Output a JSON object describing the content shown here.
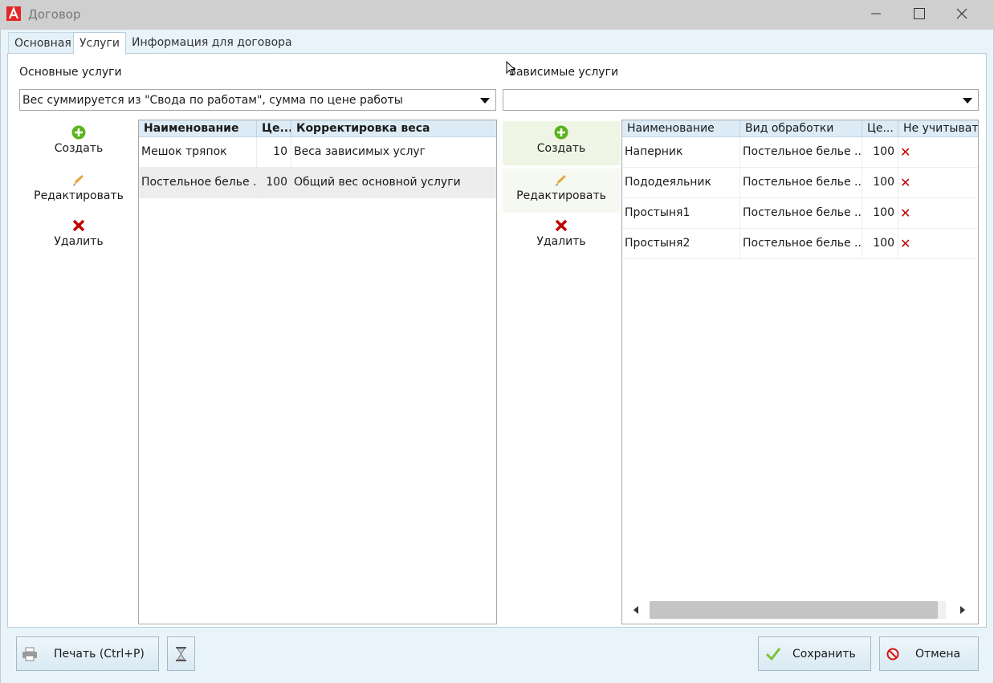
{
  "window": {
    "title": "Договор",
    "controls": {
      "minimize": "—",
      "maximize": "☐",
      "close": "✕"
    }
  },
  "tabs": [
    {
      "label": "Основная",
      "active": false
    },
    {
      "label": "Услуги",
      "active": true
    },
    {
      "label": "Информация для договора",
      "active": false
    }
  ],
  "main_services": {
    "label": "Основные услуги",
    "combo_value": "Вес суммируется из \"Свода по работам\", сумма по цене работы",
    "actions": {
      "create": "Создать",
      "edit": "Редактировать",
      "delete": "Удалить"
    },
    "columns": [
      "Наименование",
      "Це...",
      "Корректировка веса"
    ],
    "rows": [
      {
        "name": "Мешок тряпок",
        "price": "10",
        "weight": "Веса зависимых услуг"
      },
      {
        "name": "Постельное белье ...",
        "price": "100",
        "weight": "Общий вес основной услуги"
      }
    ]
  },
  "dependent_services": {
    "label": "Зависимые услуги",
    "combo_value": "",
    "actions": {
      "create": "Создать",
      "edit": "Редактировать",
      "delete": "Удалить"
    },
    "columns": [
      "Наименование",
      "Вид обработки",
      "Це...",
      "Не учитывать"
    ],
    "rows": [
      {
        "name": "Наперник",
        "processing": "Постельное белье ...",
        "price": "100",
        "exclude": "✕"
      },
      {
        "name": "Пододеяльник",
        "processing": "Постельное белье ...",
        "price": "100",
        "exclude": "✕"
      },
      {
        "name": "Простыня1",
        "processing": "Постельное белье ...",
        "price": "100",
        "exclude": "✕"
      },
      {
        "name": "Простыня2",
        "processing": "Постельное белье ...",
        "price": "100",
        "exclude": "✕"
      }
    ]
  },
  "footer": {
    "print": "Печать (Ctrl+P)",
    "save": "Сохранить",
    "cancel": "Отмена"
  },
  "colors": {
    "accent_red": "#c00000",
    "accent_green": "#5bb31d",
    "header_bg": "#dcebf5"
  }
}
